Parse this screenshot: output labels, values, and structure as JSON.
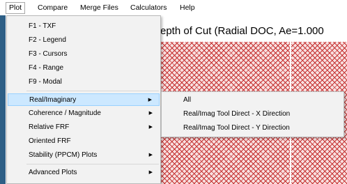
{
  "menubar": {
    "items": [
      {
        "label": "Plot"
      },
      {
        "label": "Compare"
      },
      {
        "label": "Merge Files"
      },
      {
        "label": "Calculators"
      },
      {
        "label": "Help"
      }
    ]
  },
  "plot": {
    "title_fragment": "epth of Cut (Radial DOC, Ae=1.000"
  },
  "plot_menu": {
    "items": [
      {
        "label": "F1 - TXF"
      },
      {
        "label": "F2 - Legend"
      },
      {
        "label": "F3 - Cursors"
      },
      {
        "label": "F4 - Range"
      },
      {
        "label": "F9 - Modal"
      },
      {
        "label": "Real/Imaginary"
      },
      {
        "label": "Coherence / Magnitude"
      },
      {
        "label": "Relative FRF"
      },
      {
        "label": "Oriented FRF"
      },
      {
        "label": "Stability (PPCM) Plots"
      },
      {
        "label": "Advanced Plots"
      }
    ]
  },
  "submenu": {
    "items": [
      {
        "label": "All"
      },
      {
        "label": "Real/Imag Tool Direct - X Direction"
      },
      {
        "label": "Real/Imag Tool Direct - Y Direction"
      }
    ]
  },
  "icons": {
    "submenu_arrow": "chevron-right-icon"
  },
  "colors": {
    "highlight": "#cce8ff",
    "hatch": "#c53030",
    "left_strip": "#2e5f86"
  }
}
